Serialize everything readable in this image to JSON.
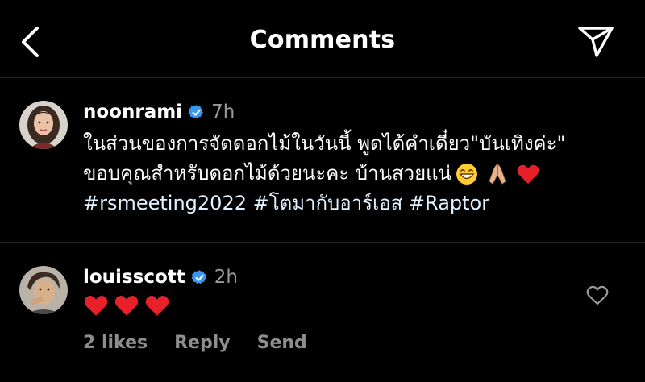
{
  "header": {
    "title": "Comments"
  },
  "post": {
    "username": "noonrami",
    "time": "7h",
    "caption_lines": [
      "ในส่วนของการจัดดอกไม้ในวันนี้ พูดได้คำเดี๋ยว\"บันเทิงค่ะ\"",
      "ขอบคุณสำหรับดอกไม้ด้วยนะคะ บ้านสวยแน่"
    ],
    "caption_emojis": [
      "grinning-face",
      "folded-hands",
      "red-heart"
    ],
    "hashtags": "#rsmeeting2022 #โตมากับอาร์เอส #Raptor"
  },
  "reply": {
    "username": "louisscott",
    "time": "2h",
    "emojis": [
      "red-heart",
      "red-heart",
      "red-heart"
    ],
    "likes": "2 likes",
    "reply_label": "Reply",
    "send_label": "Send"
  },
  "colors": {
    "background": "#000000",
    "verified": "#3897f0",
    "muted": "#8e8e8e",
    "heart": "#e8202a"
  }
}
